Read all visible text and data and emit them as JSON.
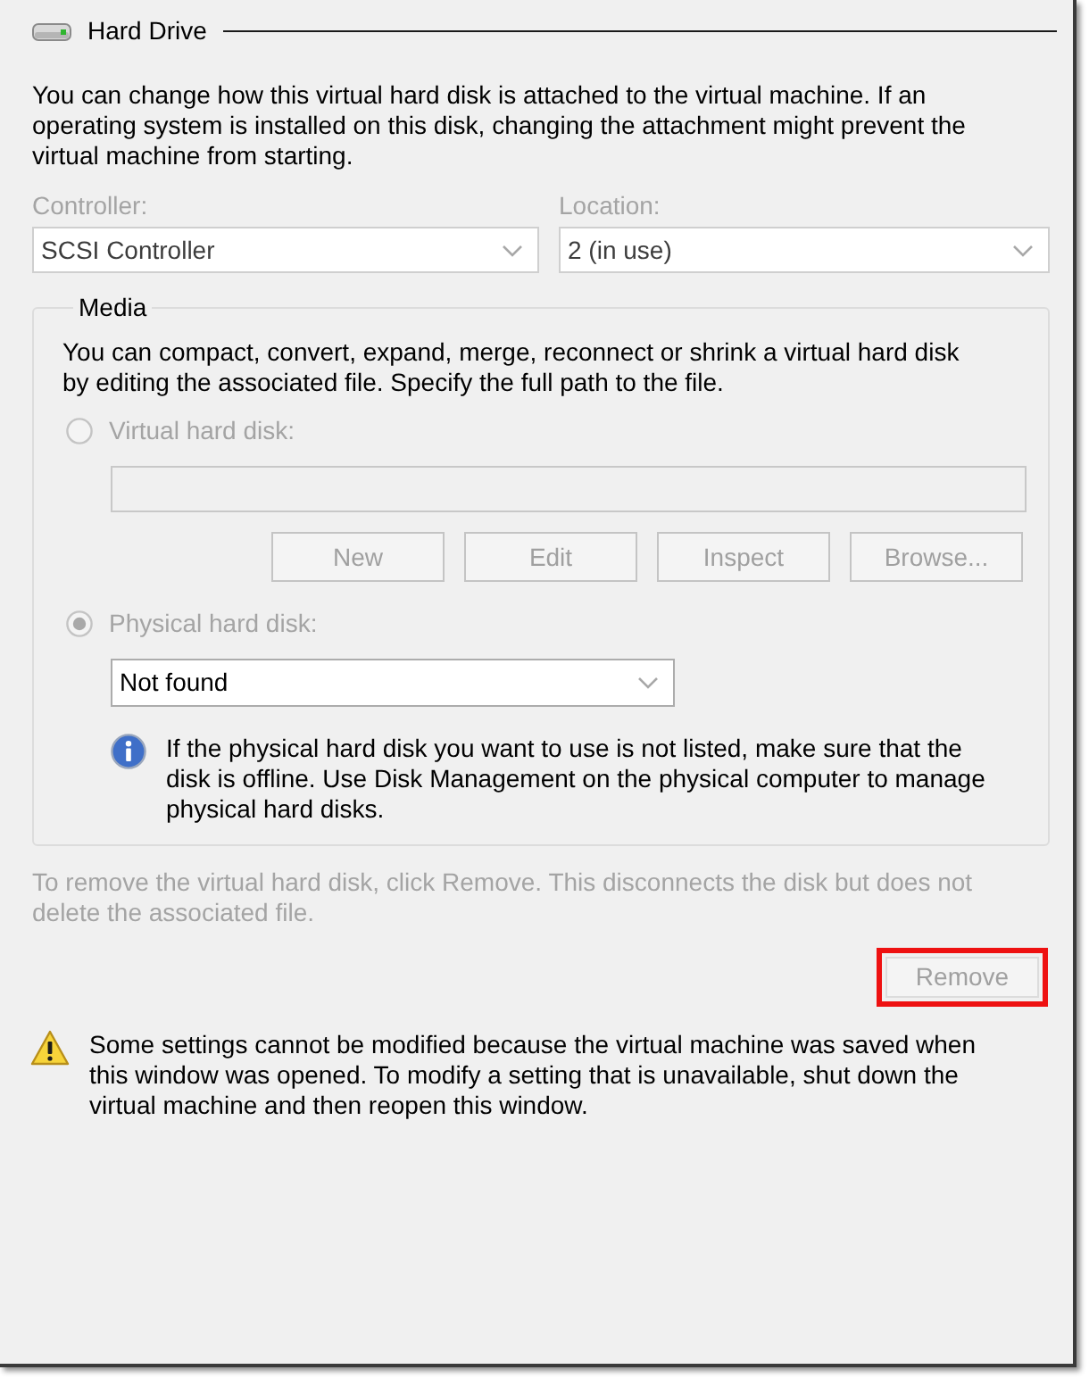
{
  "section": {
    "title": "Hard Drive"
  },
  "intro": "You can change how this virtual hard disk is attached to the virtual machine. If an operating system is installed on this disk, changing the attachment might prevent the virtual machine from starting.",
  "controller": {
    "label": "Controller:",
    "value": "SCSI Controller",
    "disabled": true
  },
  "location": {
    "label": "Location:",
    "value": "2 (in use)",
    "disabled": true
  },
  "media": {
    "title": "Media",
    "description": "You can compact, convert, expand, merge, reconnect or shrink a virtual hard disk by editing the associated file. Specify the full path to the file.",
    "virtual": {
      "label": "Virtual hard disk:",
      "selected": false,
      "disabled": true
    },
    "path_field": {
      "disabled": true
    },
    "buttons": [
      {
        "label": "New",
        "disabled": true
      },
      {
        "label": "Edit",
        "disabled": true
      },
      {
        "label": "Inspect",
        "disabled": true
      },
      {
        "label": "Browse...",
        "disabled": true
      }
    ],
    "physical": {
      "label": "Physical hard disk:",
      "selected": true,
      "disabled": true
    },
    "physical_disk": {
      "value": "Not found",
      "disabled": false
    },
    "info": "If the physical hard disk you want to use is not listed, make sure that the disk is offline. Use Disk Management on the physical computer to manage physical hard disks."
  },
  "remove_note": {
    "text": "To remove the virtual hard disk, click Remove. This disconnects the disk but does not delete the associated file.",
    "disabled": true
  },
  "remove_button": {
    "label": "Remove",
    "disabled": true,
    "highlighted": true
  },
  "warning": "Some settings cannot be modified because the virtual machine was saved when this window was opened. To modify a setting that is unavailable, shut down the virtual machine and then reopen this window."
}
